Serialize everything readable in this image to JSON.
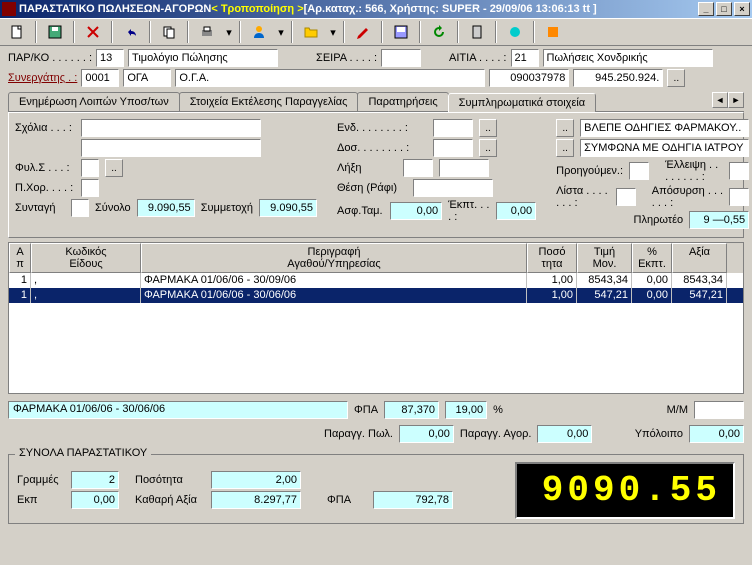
{
  "title": {
    "main": "ΠΑΡΑΣΤΑΤΙΚΟ ΠΩΛΗΣΕΩΝ-ΑΓΟΡΩΝ ",
    "mode": "< Τροποποίηση >",
    "detail": " [Αρ.καταχ.: 566, Χρήστης: SUPER - 29/09/06 13:06:13 tt ]"
  },
  "header": {
    "parko_label": "ΠΑΡ/ΚΟ . . . . . . :",
    "parko_code": "13",
    "parko_desc": "Τιμολόγιο Πώλησης",
    "seira_label": "ΣΕΙΡΑ . . . . :",
    "seira": "",
    "aitia_label": "ΑΙΤΙΑ . . . . :",
    "aitia_code": "21",
    "aitia_desc": "Πωλήσεις Χονδρικής",
    "synergatis_label": "Συνεργάτης . :",
    "syn_code": "0001",
    "syn_name": "ΟΓΑ",
    "syn_field": "Ο.Γ.Α.",
    "syn_num": "090037978",
    "syn_phone": "945.250.924."
  },
  "tabs": [
    "Ενημέρωση Λοιπών Υποσ/των",
    "Στοιχεία Εκτέλεσης Παραγγελίας",
    "Παρατηρήσεις",
    "Συμπληρωματικά στοιχεία"
  ],
  "active_tab": 3,
  "supp": {
    "sxolia": "Σχόλια . . . :",
    "fyls": "Φυλ.Σ . . . :",
    "pxor": "Π.Χορ. . . . :",
    "syntagi": "Συνταγή",
    "synolo_label": "Σύνολο",
    "synolo": "9.090,55",
    "symmetohi_label": "Συμμετοχή",
    "symmetohi": "9.090,55",
    "end": "Ενδ. . . . . . . . :",
    "dos": "Δοσ. . . . . . . . :",
    "liksi": "Λήξη",
    "thesi": "Θέση (Ράφι)",
    "asftam": "Ασφ.Ταμ.",
    "asftam_val": "0,00",
    "ekpt_label": "Έκπτ. . . . :",
    "ekpt_val": "0,00",
    "note1": "ΒΛΕΠΕ ΟΔΗΓΙΕΣ ΦΑΡΜΑΚΟΥ..",
    "note2": "ΣΥΜΦΩΝΑ ΜΕ ΟΔΗΓΙΑ ΙΑΤΡΟΥ",
    "proig": "Προηγούμεν.:",
    "lista": "Λίστα . . . . . . . :",
    "elleipsi": "Έλλειψη . . . . . . . . :",
    "aposyrsi": "Απόσυρση . . . . . . :",
    "plhrwteo": "Πληρωτέο",
    "plhrwteo_val": "9 —0,55"
  },
  "grid": {
    "headers": {
      "ap": "Α\nπ",
      "kod": "Κωδικός\nΕίδους",
      "per": "Περιγραφή\nΑγαθού/Υπηρεσίας",
      "pos": "Ποσό\nτητα",
      "timi": "Τιμή\nΜον.",
      "ekpt": "%\nΕκπτ.",
      "aksia": "Αξία"
    },
    "rows": [
      {
        "ap": "1",
        "kod": ",",
        "per": "ΦΑΡΜΑΚΑ 01/06/06 - 30/09/06",
        "pos": "1,00",
        "timi": "8543,34",
        "ekpt": "0,00",
        "aksia": "8543,34",
        "sel": false
      },
      {
        "ap": "1",
        "kod": ",",
        "per": "ΦΑΡΜΑΚΑ 01/06/06 - 30/06/06",
        "pos": "1,00",
        "timi": "547,21",
        "ekpt": "0,00",
        "aksia": "547,21",
        "sel": true
      }
    ]
  },
  "detail": {
    "desc": "ΦΑΡΜΑΚΑ 01/06/06 - 30/06/06",
    "fpa_label": "ΦΠΑ",
    "fpa": "87,370",
    "fpa_pct": "19,00",
    "pct": "%",
    "mm_label": "Μ/Μ",
    "mm": "",
    "paraggpol_label": "Παραγγ. Πωλ.",
    "paraggpol": "0,00",
    "paraggagor_label": "Παραγγ. Αγορ.",
    "paraggagor": "0,00",
    "ypoloipo_label": "Υπόλοιπο",
    "ypoloipo": "0,00"
  },
  "totals": {
    "title": "ΣΥΝΟΛΑ ΠΑΡΑΣΤΑΤΙΚΟΥ",
    "grammes_label": "Γραμμές",
    "grammes": "2",
    "posotita_label": "Ποσότητα",
    "posotita": "2,00",
    "ekp_label": "Εκπ",
    "ekp": "0,00",
    "kathari_label": "Καθαρή Αξία",
    "kathari": "8.297,77",
    "fpa_label": "ΦΠΑ",
    "fpa": "792,78",
    "display": "9090.55"
  }
}
